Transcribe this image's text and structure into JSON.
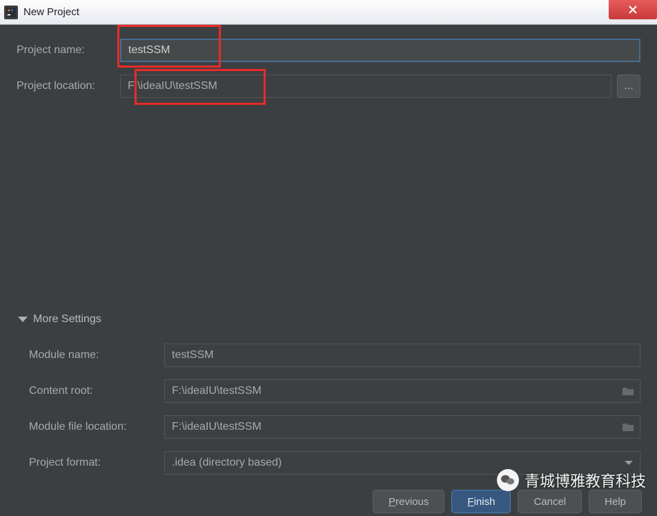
{
  "window": {
    "title": "New Project"
  },
  "form": {
    "projectNameLabel": "Project name:",
    "projectNameValue": "testSSM",
    "projectLocationLabel": "Project location:",
    "projectLocationValue": "F:\\ideaIU\\testSSM",
    "browseLabel": "..."
  },
  "moreSettings": {
    "header": "More Settings",
    "moduleNameLabel": "Module name:",
    "moduleNameValue": "testSSM",
    "contentRootLabel": "Content root:",
    "contentRootValue": "F:\\ideaIU\\testSSM",
    "moduleFileLocationLabel": "Module file location:",
    "moduleFileLocationValue": "F:\\ideaIU\\testSSM",
    "projectFormatLabel": "Project format:",
    "projectFormatValue": ".idea (directory based)"
  },
  "buttons": {
    "previous": "Previous",
    "finish": "Finish",
    "cancel": "Cancel",
    "help": "Help"
  },
  "watermark": {
    "text": "青城博雅教育科技"
  }
}
